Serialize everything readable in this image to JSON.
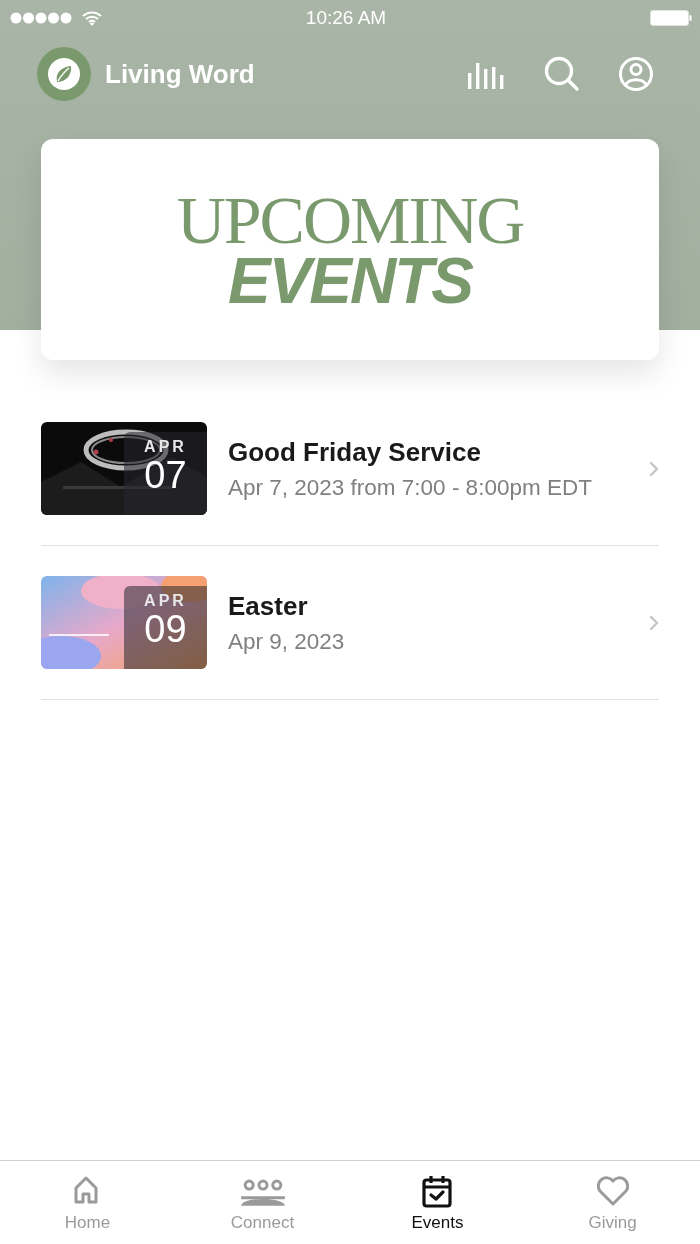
{
  "status_bar": {
    "time": "10:26 AM"
  },
  "header": {
    "title": "Living Word"
  },
  "banner": {
    "line_1": "UPCOMING",
    "line_2": "EVENTS"
  },
  "events": [
    {
      "title": "Good Friday Service",
      "subtitle": "Apr 7, 2023 from 7:00 - 8:00pm EDT",
      "month": "APR",
      "day": "07",
      "kind": "picture"
    },
    {
      "title": "Easter",
      "subtitle": "Apr 9, 2023",
      "month": "APR",
      "day": "09",
      "kind": "picture"
    }
  ],
  "tabs": [
    {
      "label": "Home",
      "kind": "home",
      "selected": false
    },
    {
      "label": "Connect",
      "kind": "people",
      "selected": false
    },
    {
      "label": "Events",
      "kind": "calendar",
      "selected": true
    },
    {
      "label": "Giving",
      "kind": "heart",
      "selected": false
    }
  ]
}
